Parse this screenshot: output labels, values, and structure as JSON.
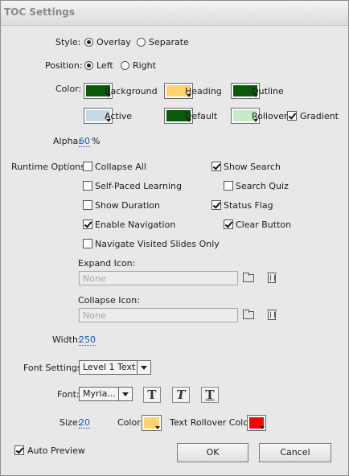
{
  "window": {
    "title": "TOC Settings"
  },
  "style": {
    "label": "Style:",
    "options": [
      "Overlay",
      "Separate"
    ],
    "selected": "Overlay"
  },
  "position": {
    "label": "Position:",
    "options": [
      "Left",
      "Right"
    ],
    "selected": "Left"
  },
  "color": {
    "label": "Color:",
    "swatches": [
      {
        "label": "Background",
        "color": "#0a5a0a"
      },
      {
        "label": "Heading",
        "color": "#ffd36b"
      },
      {
        "label": "Outline",
        "color": "#0a5a0a"
      },
      {
        "label": "Active",
        "color": "#c9d8e6"
      },
      {
        "label": "Default",
        "color": "#0a5a0a"
      },
      {
        "label": "Rollover",
        "color": "#c5ecc5"
      }
    ],
    "gradient_label": "Gradient",
    "gradient_checked": true
  },
  "alpha": {
    "label": "Alpha:",
    "value": "60",
    "unit": "%"
  },
  "runtime": {
    "label": "Runtime Options:",
    "left": [
      {
        "label": "Collapse All",
        "checked": false
      },
      {
        "label": "Self-Paced Learning",
        "checked": false
      },
      {
        "label": "Show Duration",
        "checked": false
      },
      {
        "label": "Enable Navigation",
        "checked": true
      },
      {
        "label": "Navigate Visited Slides Only",
        "checked": false
      }
    ],
    "right": [
      {
        "label": "Show Search",
        "checked": true
      },
      {
        "label": "Search Quiz",
        "checked": false
      },
      {
        "label": "Status Flag",
        "checked": true
      },
      {
        "label": "Clear Button",
        "checked": true
      }
    ]
  },
  "expand_icon": {
    "label": "Expand Icon:",
    "placeholder": "None"
  },
  "collapse_icon": {
    "label": "Collapse Icon:",
    "placeholder": "None"
  },
  "width": {
    "label": "Width:",
    "value": "250"
  },
  "font_settings": {
    "label": "Font Settings:",
    "value": "Level 1 Text"
  },
  "font": {
    "label": "Font:",
    "value": "Myria..."
  },
  "size": {
    "label": "Size:",
    "value": "20"
  },
  "font_color": {
    "label": "Color:",
    "color": "#ffd36b"
  },
  "text_rollover_color": {
    "label": "Text Rollover Color:",
    "color": "#ff0000"
  },
  "auto_preview": {
    "label": "Auto Preview",
    "checked": true
  },
  "buttons": {
    "ok": "OK",
    "cancel": "Cancel"
  }
}
